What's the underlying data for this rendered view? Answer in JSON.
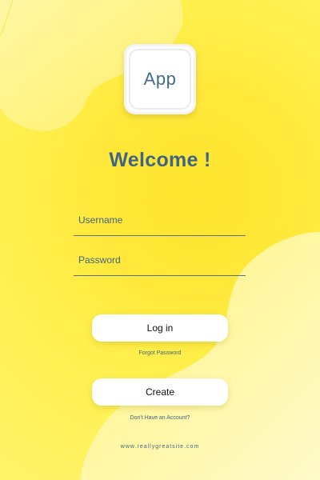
{
  "app": {
    "logo_text": "App"
  },
  "welcome": {
    "title": "Welcome !"
  },
  "form": {
    "username_label": "Username",
    "password_label": "Password"
  },
  "actions": {
    "login_label": "Log in",
    "forgot_label": "Forgot Password",
    "create_label": "Create",
    "no_account_label": "Don't Have an Account?"
  },
  "footer": {
    "website": "www.reallygreatsite.com"
  },
  "colors": {
    "background": "#ffe83a",
    "accent_text": "#3f6585",
    "button_bg": "#ffffff"
  }
}
